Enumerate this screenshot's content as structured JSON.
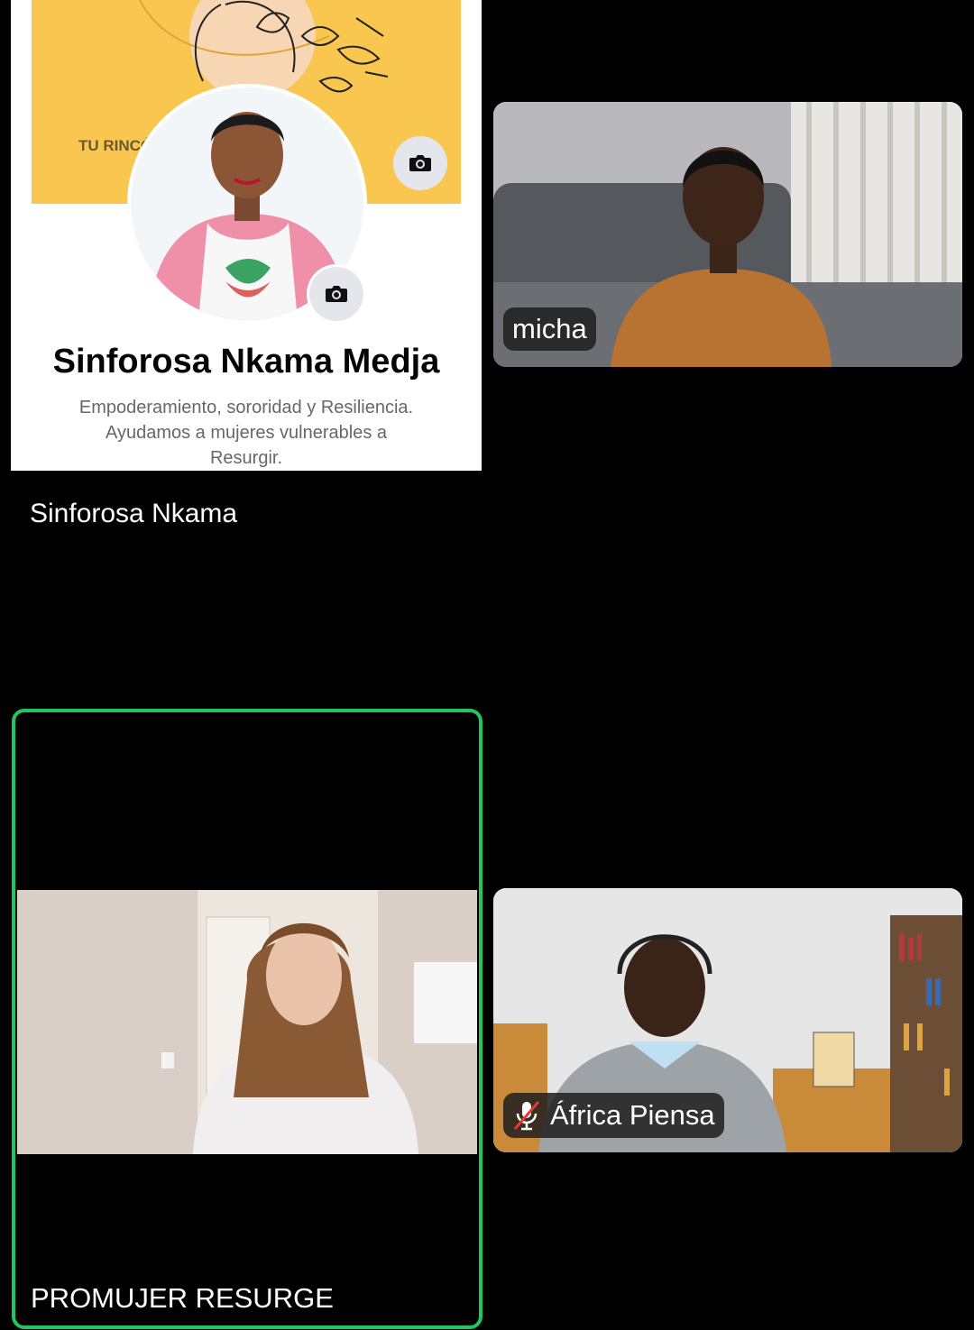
{
  "tiles": {
    "profile": {
      "cover_text": "TU RINCÓ",
      "profile_name": "Sinforosa Nkama Medja",
      "bio_line_1": "Empoderamiento, sororidad y Resiliencia.",
      "bio_line_2": "Ayudamos a mujeres vulnerables a",
      "bio_line_3": "Resurgir.",
      "participant_name": "Sinforosa Nkama"
    },
    "micha": {
      "participant_name": "micha"
    },
    "speaker": {
      "participant_name": "PROMUJER RESURGE",
      "active_speaker": true,
      "highlight_color": "#22c55e"
    },
    "africa": {
      "participant_name": "África Piensa",
      "muted": true
    }
  },
  "colors": {
    "background": "#000000",
    "active_border": "#22c55e",
    "cover_yellow": "#f9c74f",
    "mute_red": "#e53935"
  },
  "icons": [
    "camera-icon",
    "mic-muted-icon"
  ]
}
